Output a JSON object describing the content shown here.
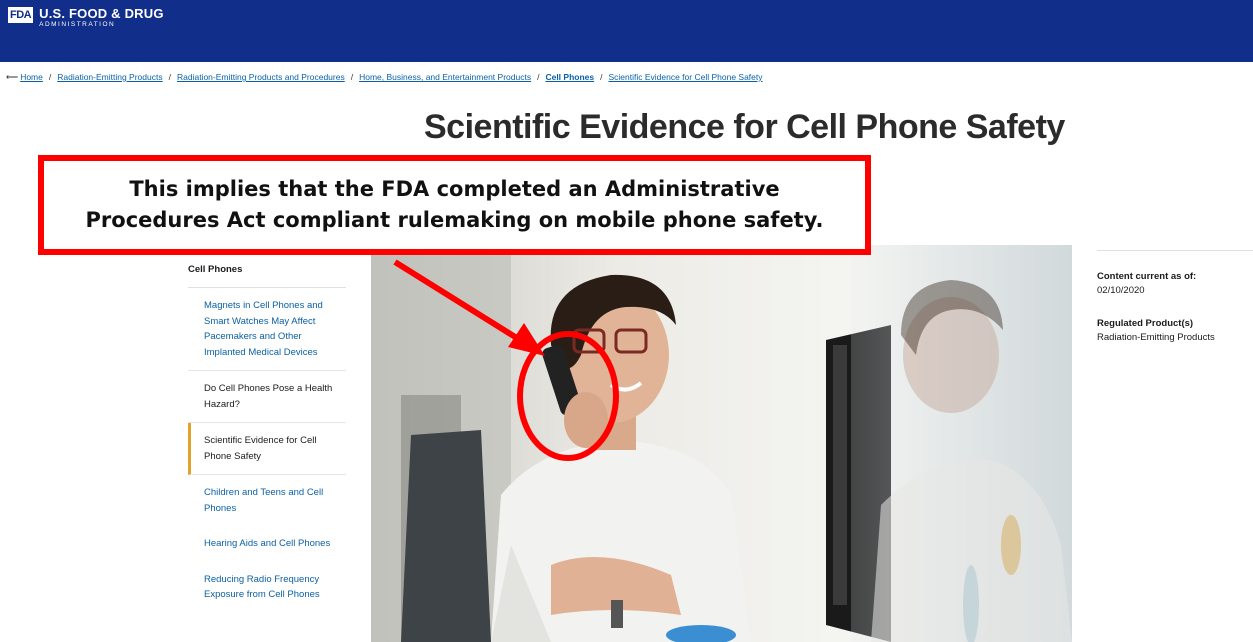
{
  "header": {
    "logo_badge": "FDA",
    "title": "U.S. FOOD & DRUG",
    "subtitle": "ADMINISTRATION",
    "bg_color": "#112e8a"
  },
  "breadcrumb": {
    "back_icon": "left-arrow-icon",
    "items": [
      "Home",
      "Radiation-Emitting Products",
      "Radiation-Emitting Products and Procedures",
      "Home, Business, and Entertainment Products",
      "Cell Phones",
      "Scientific Evidence for Cell Phone Safety"
    ]
  },
  "page": {
    "title": "Scientific Evidence for Cell Phone Safety"
  },
  "annotation": {
    "text": "This implies that the FDA completed an Administrative Procedures Act compliant rulemaking on mobile phone safety.",
    "color": "#ff0000"
  },
  "sidebar": {
    "heading": "Cell Phones",
    "items": [
      "Magnets in Cell Phones and Smart Watches May Affect Pacemakers and Other Implanted Medical Devices",
      "Do Cell Phones Pose a Health Hazard?",
      "Scientific Evidence for Cell Phone Safety",
      "Children and Teens and Cell Phones",
      "Hearing Aids and Cell Phones",
      "Reducing Radio Frequency Exposure from Cell Phones"
    ],
    "current_accent": "#e1a32b"
  },
  "meta": {
    "content_label": "Content current as of:",
    "content_date": "02/10/2020",
    "product_label": "Regulated Product(s)",
    "product_value": "Radiation-Emitting Products"
  }
}
